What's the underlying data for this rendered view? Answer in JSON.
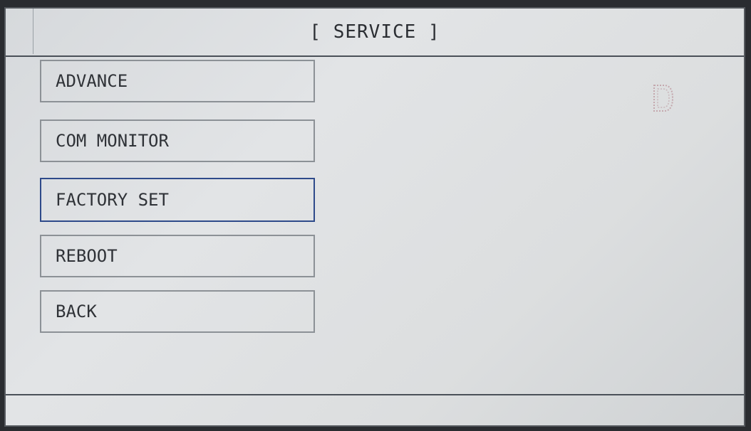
{
  "header": {
    "title": "[ SERVICE ]"
  },
  "menu": {
    "items": [
      {
        "label": "ADVANCE",
        "selected": false
      },
      {
        "label": "COM MONITOR",
        "selected": false
      },
      {
        "label": "FACTORY SET",
        "selected": true
      },
      {
        "label": "REBOOT",
        "selected": false
      },
      {
        "label": "BACK",
        "selected": false
      }
    ]
  },
  "status": {
    "indicator_icon": "d-indicator-icon"
  },
  "colors": {
    "selected_border": "#2e4a8a",
    "button_border": "#8c9196",
    "divider": "#4a5058"
  }
}
